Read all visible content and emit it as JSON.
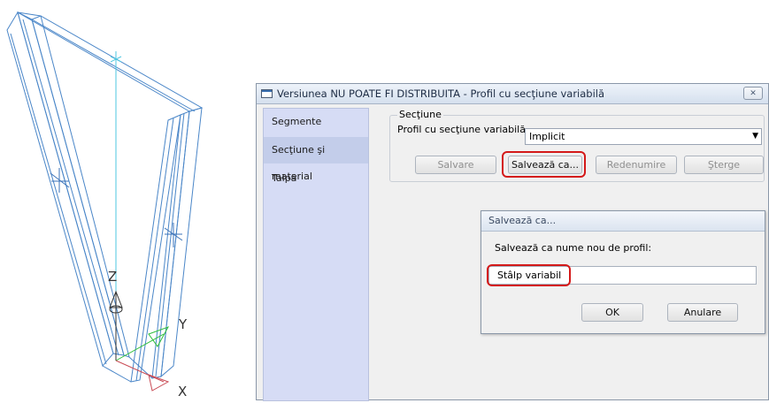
{
  "cad": {
    "axis_labels": {
      "z": "Z",
      "y": "Y",
      "x": "X"
    }
  },
  "main_dialog": {
    "title": "Versiunea NU POATE FI DISTRIBUITA - Profil cu secţiune variabilă",
    "close_icon": "close-icon",
    "sidebar": {
      "items": [
        {
          "label": "Segmente"
        },
        {
          "label": "Secţiune şi material",
          "selected": true
        },
        {
          "label": "Talpă"
        }
      ]
    },
    "section_group": {
      "legend": "Secţiune",
      "profile_label": "Profil cu secţiune variabilă",
      "profile_value": "Implicit",
      "buttons": {
        "save": "Salvare",
        "save_as": "Salvează ca...",
        "rename": "Redenumire",
        "delete": "Şterge"
      }
    }
  },
  "save_as_dialog": {
    "title": "Salvează ca...",
    "prompt": "Salvează ca nume nou de profil:",
    "input_value": "Stâlp variabil",
    "ok_label": "OK",
    "cancel_label": "Anulare"
  },
  "colors": {
    "highlight": "#d41a1a",
    "wireframe": "#4a86c8",
    "axis_line": "#4ec7e0",
    "sidebar_bg": "#d6dcf5"
  }
}
